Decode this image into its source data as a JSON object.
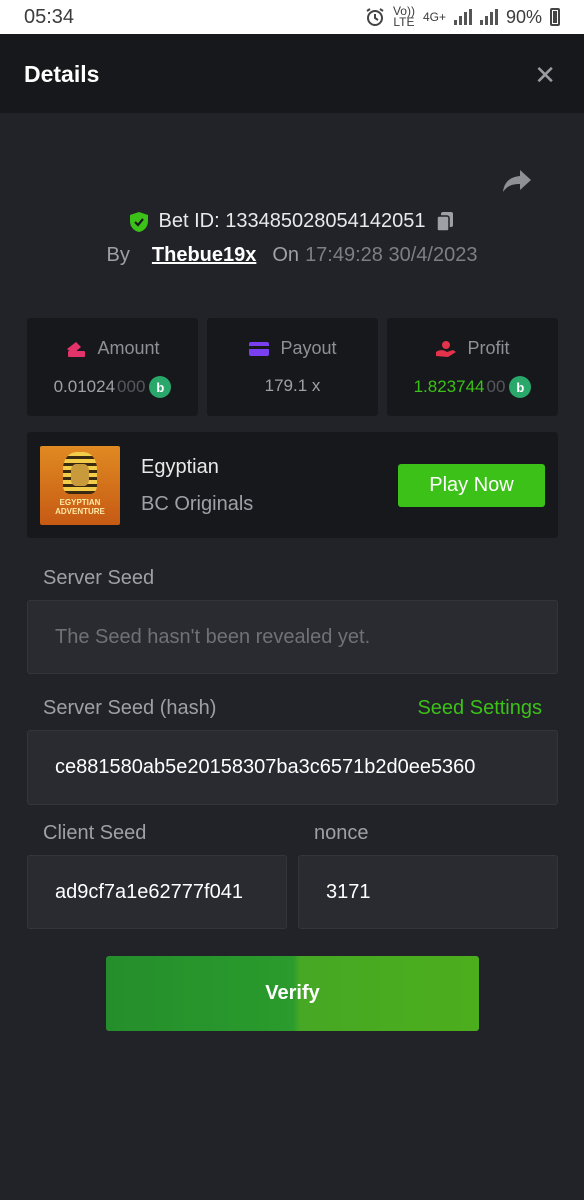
{
  "status_bar": {
    "time": "05:34",
    "volte": "Vo)) LTE",
    "network": "4G+",
    "battery": "90%"
  },
  "header": {
    "title": "Details",
    "close": "✕"
  },
  "bet": {
    "id_label": "Bet ID: 133485028054142051",
    "by_label": "By",
    "user": "Thebue19x",
    "on_label": "On",
    "datetime": "17:49:28 30/4/2023"
  },
  "stats": {
    "amount": {
      "label": "Amount",
      "value_main": "0.01024",
      "value_fade": "000",
      "coin": "b"
    },
    "payout": {
      "label": "Payout",
      "value": "179.1 x"
    },
    "profit": {
      "label": "Profit",
      "value_main": "1.823744",
      "value_fade": "00",
      "coin": "b"
    }
  },
  "game": {
    "name": "Egyptian",
    "provider": "BC Originals",
    "thumb_line1": "EGYPTIAN",
    "thumb_line2": "ADVENTURE",
    "play_label": "Play Now"
  },
  "seeds": {
    "server_seed_label": "Server Seed",
    "server_seed_value": "The Seed hasn't been revealed yet.",
    "server_hash_label": "Server Seed (hash)",
    "seed_settings_label": "Seed Settings",
    "server_hash_value": "ce881580ab5e20158307ba3c6571b2d0ee5360",
    "client_seed_label": "Client Seed",
    "client_seed_value": "ad9cf7a1e62777f041",
    "nonce_label": "nonce",
    "nonce_value": "3171"
  },
  "verify_label": "Verify",
  "colors": {
    "accent_green": "#3bc117",
    "amount_icon": "#e2336b",
    "payout_icon": "#7b3ff2",
    "profit_icon": "#e2334a",
    "coin": "#2aa76a"
  }
}
